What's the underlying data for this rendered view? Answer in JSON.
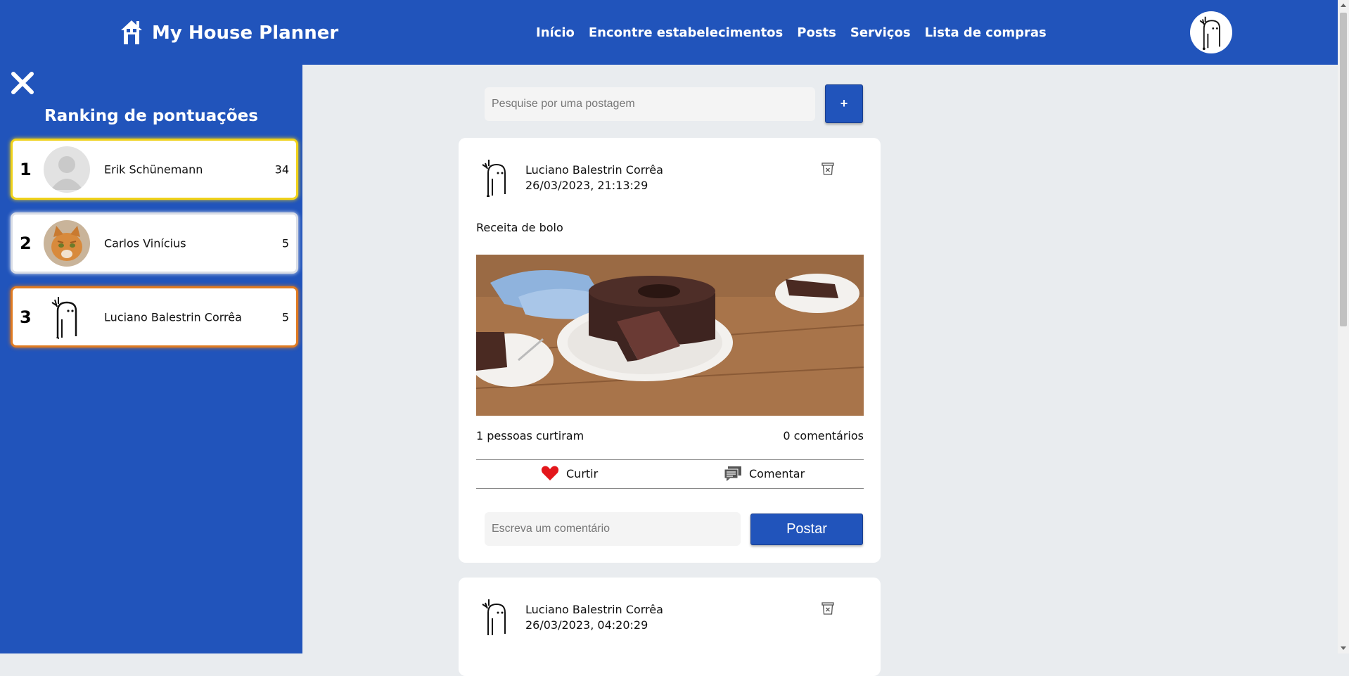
{
  "header": {
    "brand": "My House Planner",
    "nav": [
      "Início",
      "Encontre estabelecimentos",
      "Posts",
      "Serviços",
      "Lista de compras"
    ]
  },
  "sidebar": {
    "title": "Ranking de pontuações",
    "ranking": [
      {
        "position": "1",
        "name": "Erik Schünemann",
        "score": "34",
        "border": "#f0d21a"
      },
      {
        "position": "2",
        "name": "Carlos Vinícius",
        "score": "5",
        "border": "#d9dde6"
      },
      {
        "position": "3",
        "name": "Luciano Balestrin Corrêa",
        "score": "5",
        "border": "#e07b22"
      }
    ]
  },
  "search": {
    "placeholder": "Pesquise por uma postagem",
    "add_label": "+"
  },
  "posts": [
    {
      "author": "Luciano Balestrin Corrêa",
      "date": "26/03/2023, 21:13:29",
      "text": "Receita de bolo",
      "likes": "1 pessoas curtiram",
      "comments": "0 comentários",
      "like_label": "Curtir",
      "comment_label": "Comentar",
      "comment_placeholder": "Escreva um comentário",
      "post_button": "Postar"
    },
    {
      "author": "Luciano Balestrin Corrêa",
      "date": "26/03/2023, 04:20:29"
    }
  ],
  "colors": {
    "primary": "#2154bb",
    "background": "#e9ecef",
    "like": "#e3161b"
  }
}
